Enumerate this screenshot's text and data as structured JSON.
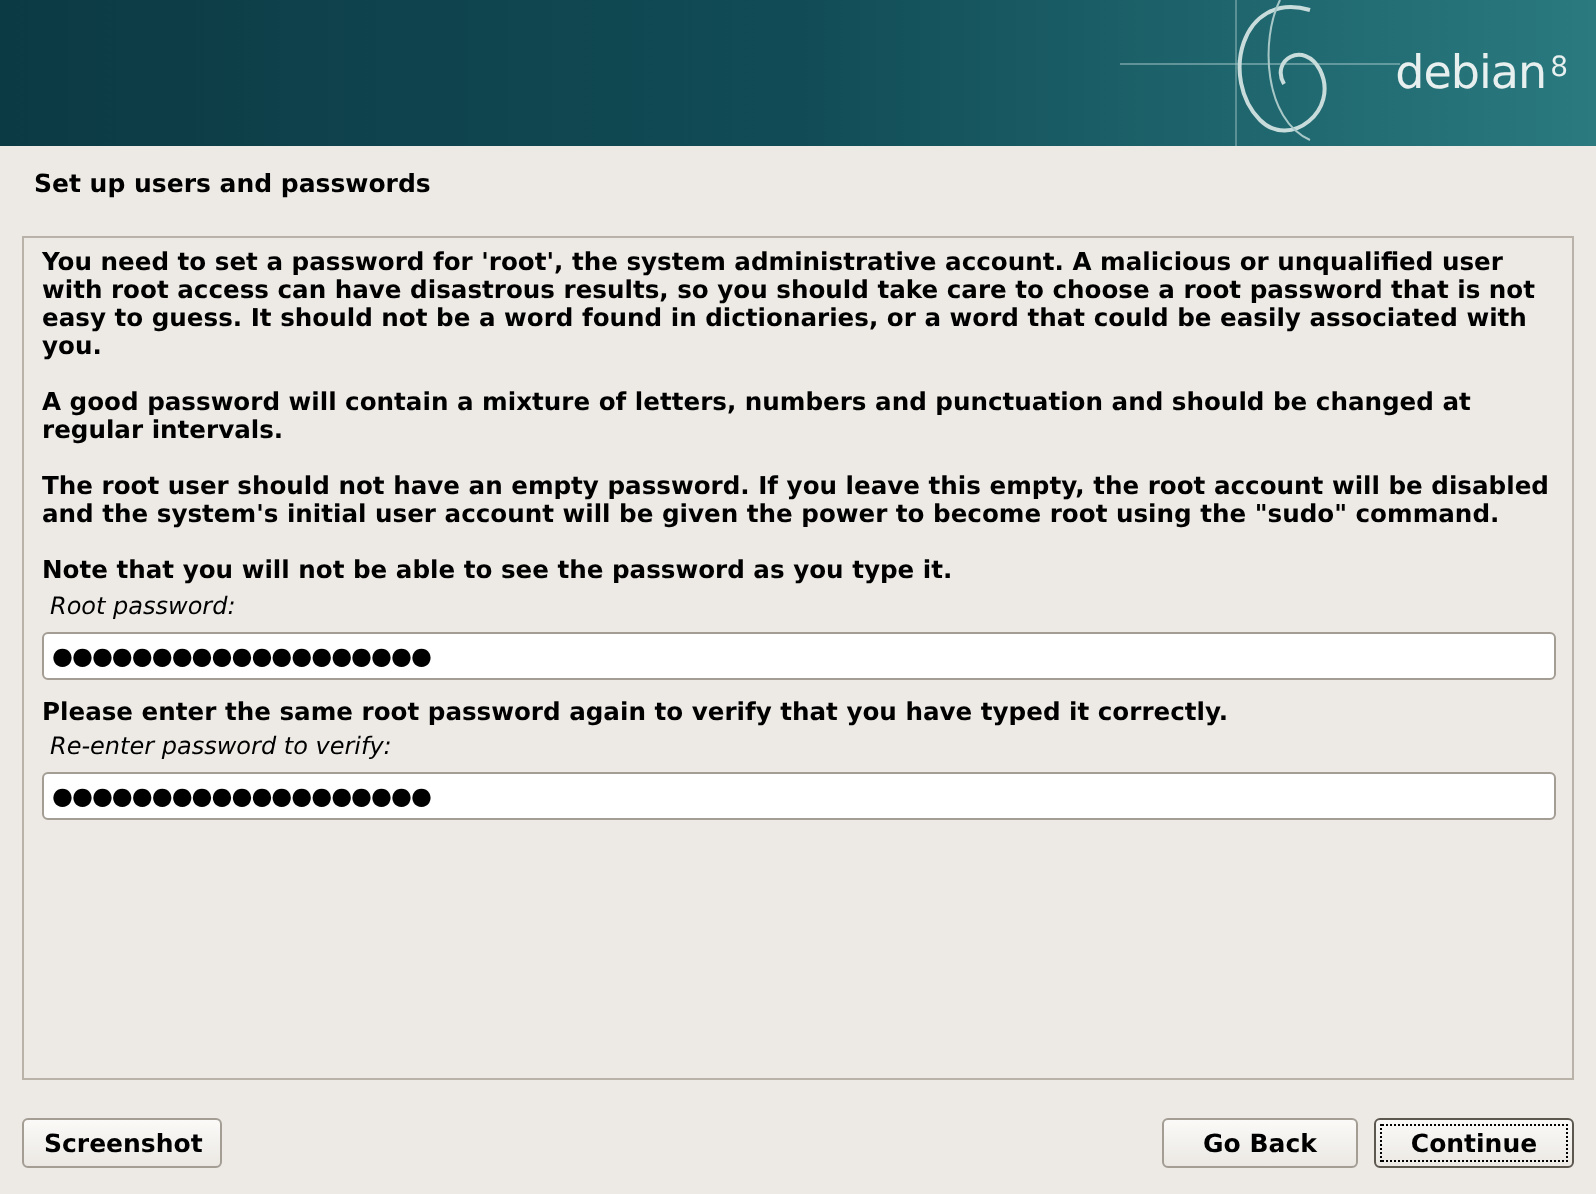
{
  "header": {
    "logo_text": "debian",
    "version": "8"
  },
  "title": "Set up users and passwords",
  "paragraphs": [
    "You need to set a password for 'root', the system administrative account. A malicious or unqualified user with root access can have disastrous results, so you should take care to choose a root password that is not easy to guess. It should not be a word found in dictionaries, or a word that could be easily associated with you.",
    "A good password will contain a mixture of letters, numbers and punctuation and should be changed at regular intervals.",
    "The root user should not have an empty password. If you leave this empty, the root account will be disabled and the system's initial user account will be given the power to become root using the \"sudo\" command.",
    "Note that you will not be able to see the password as you type it."
  ],
  "fields": [
    {
      "label": "Root password:",
      "value": "●●●●●●●●●●●●●●●●●●●"
    },
    {
      "prompt": "Please enter the same root password again to verify that you have typed it correctly.",
      "label": "Re-enter password to verify:",
      "value": "●●●●●●●●●●●●●●●●●●●"
    }
  ],
  "buttons": [
    {
      "label": "Screenshot",
      "focused": false
    },
    {
      "label": "Go Back",
      "focused": false
    },
    {
      "label": "Continue",
      "focused": true
    }
  ]
}
